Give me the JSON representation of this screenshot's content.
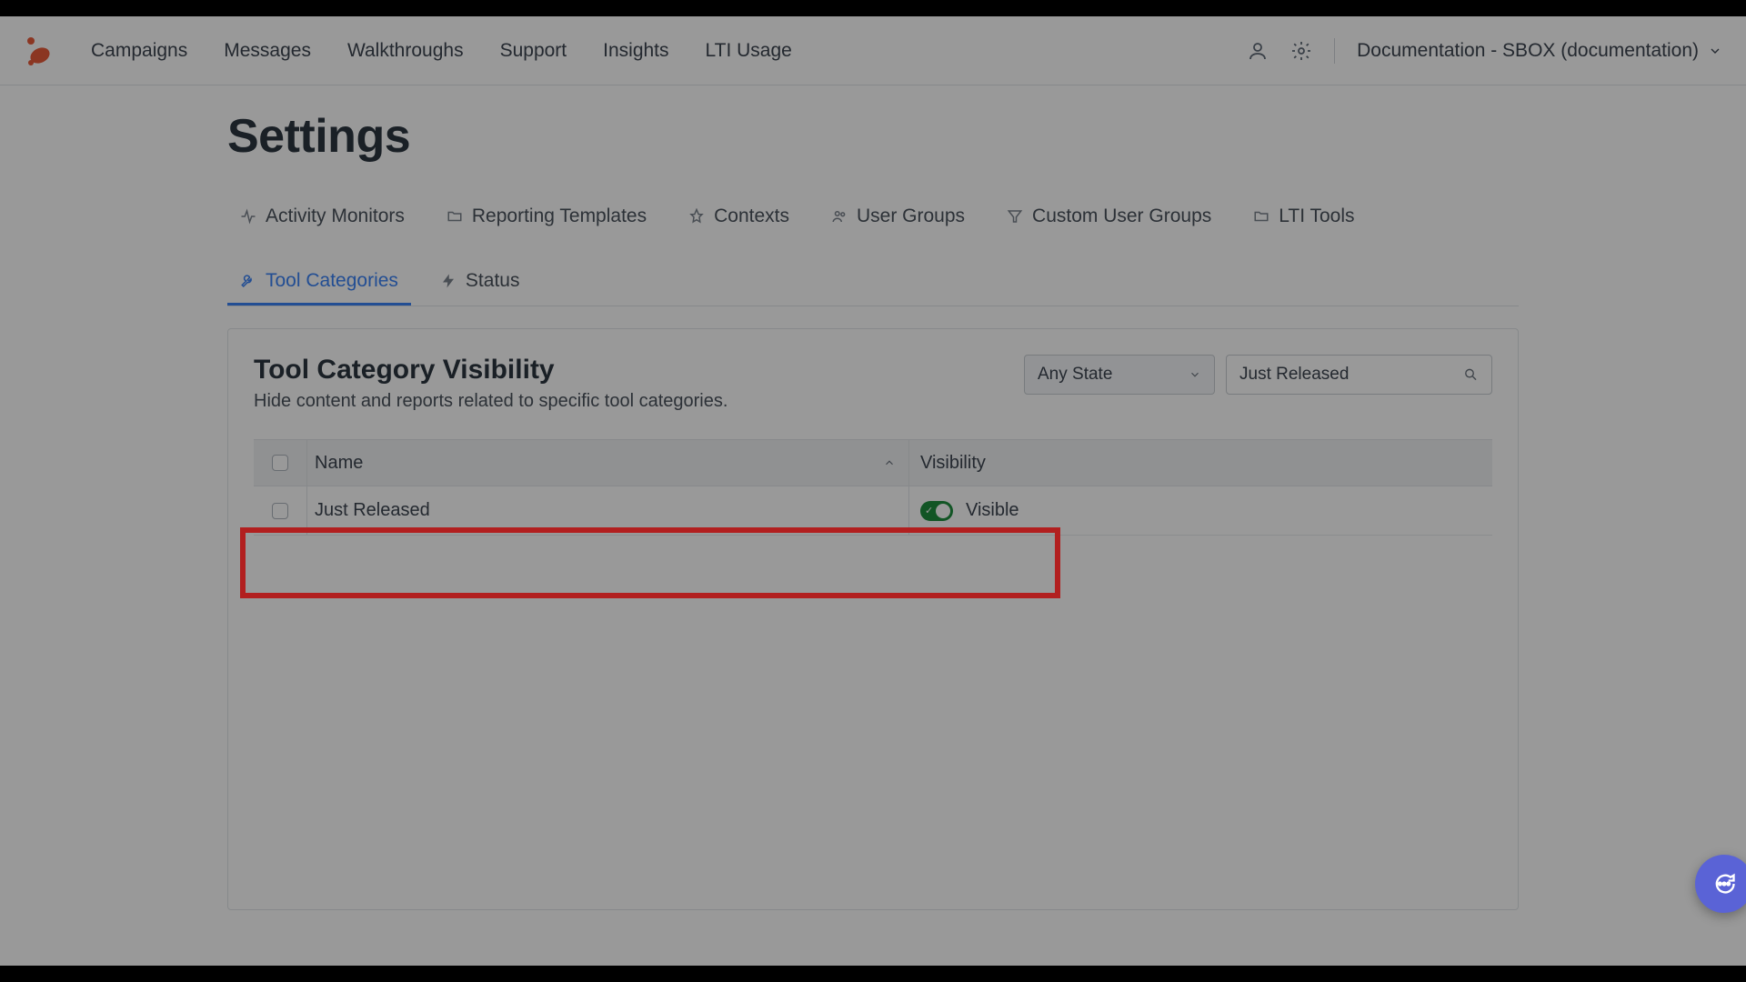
{
  "topnav": {
    "items": [
      "Campaigns",
      "Messages",
      "Walkthroughs",
      "Support",
      "Insights",
      "LTI Usage"
    ]
  },
  "account": {
    "label": "Documentation - SBOX (documentation)"
  },
  "page": {
    "title": "Settings"
  },
  "tabs": {
    "items": [
      {
        "label": "Activity Monitors"
      },
      {
        "label": "Reporting Templates"
      },
      {
        "label": "Contexts"
      },
      {
        "label": "User Groups"
      },
      {
        "label": "Custom User Groups"
      },
      {
        "label": "LTI Tools"
      },
      {
        "label": "Tool Categories"
      },
      {
        "label": "Status"
      }
    ]
  },
  "panel": {
    "title": "Tool Category Visibility",
    "description": "Hide content and reports related to specific tool categories.",
    "state_dropdown": "Any State",
    "search_value": "Just Released"
  },
  "table": {
    "headers": {
      "name": "Name",
      "visibility": "Visibility"
    },
    "rows": [
      {
        "name": "Just Released",
        "visibility": "Visible",
        "toggled": true
      }
    ]
  }
}
